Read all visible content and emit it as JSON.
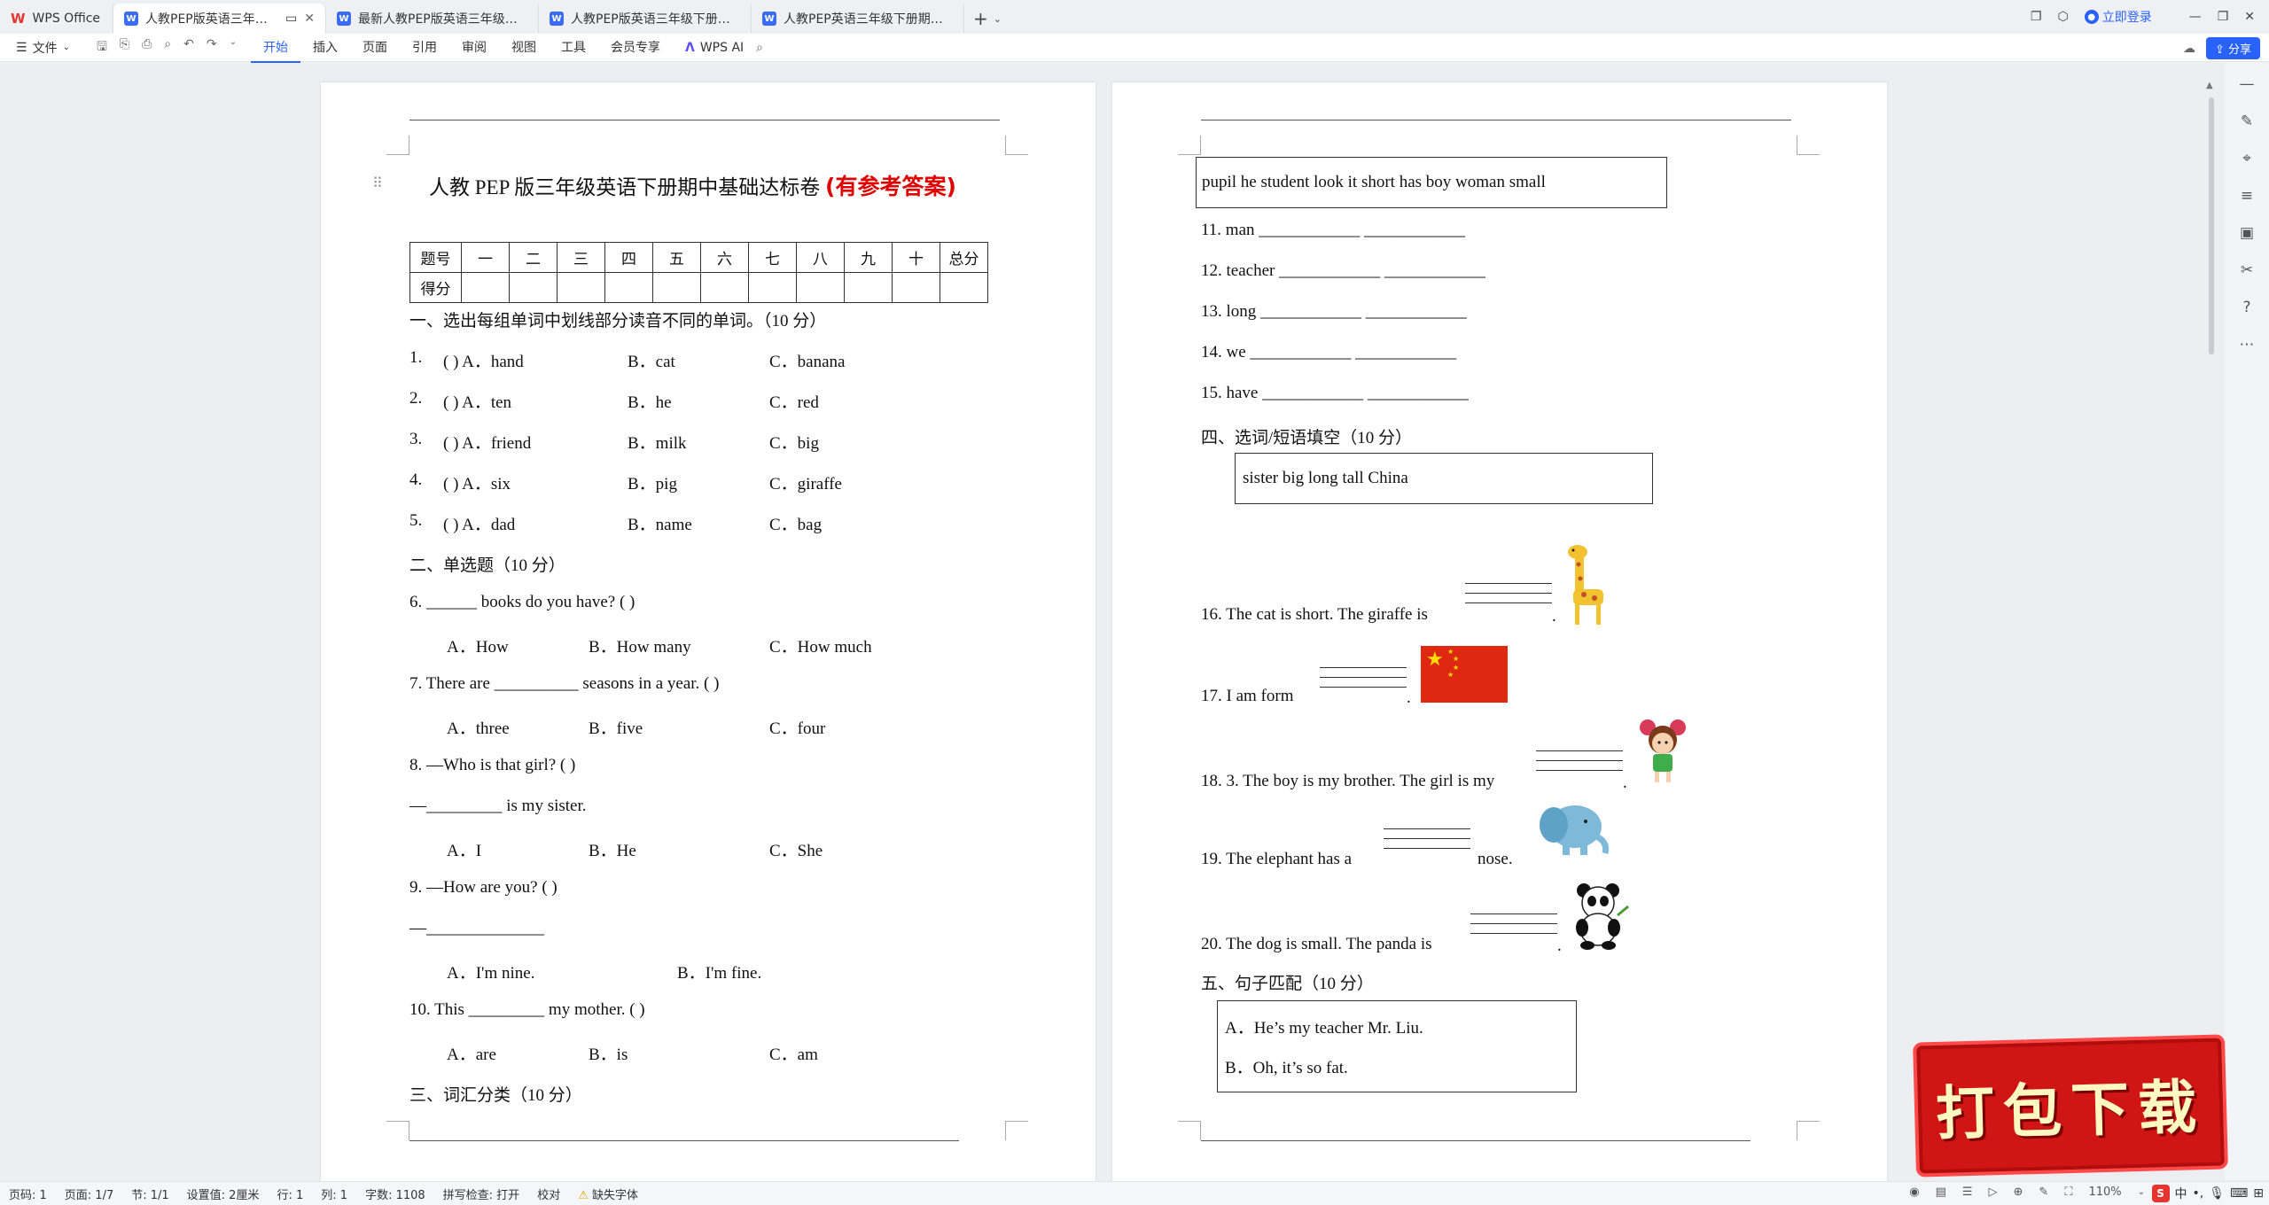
{
  "titlebar": {
    "home_tab": "WPS Office",
    "tabs": [
      {
        "label": "人教PEP版英语三年级下册期中",
        "active": true
      },
      {
        "label": "最新人教PEP版英语三年级下册期中综合"
      },
      {
        "label": "人教PEP版英语三年级下册期中能力提"
      },
      {
        "label": "人教PEP英语三年级下册期中综合素质"
      }
    ],
    "login": "立即登录"
  },
  "ribbon": {
    "file": "文件",
    "menus": [
      "开始",
      "插入",
      "页面",
      "引用",
      "审阅",
      "视图",
      "工具",
      "会员专享"
    ],
    "active_menu": "开始",
    "ai": "WPS AI",
    "share": "分享",
    "accent": "#2962ff"
  },
  "page1": {
    "title": "人教 PEP 版三年级英语下册期中基础达标卷",
    "title_red": "(有参考答案)",
    "score_table": {
      "header": [
        "题号",
        "一",
        "二",
        "三",
        "四",
        "五",
        "六",
        "七",
        "八",
        "九",
        "十",
        "总分"
      ],
      "row2_label": "得分"
    },
    "sec1": "一、选出每组单词中划线部分读音不同的单词。（10 分）",
    "q1": [
      "1.",
      "(     ) A．hand",
      "B．cat",
      "C．banana"
    ],
    "q2": [
      "2.",
      "(     ) A．ten",
      "B．he",
      "C．red"
    ],
    "q3": [
      "3.",
      "(     ) A．friend",
      "B．milk",
      "C．big"
    ],
    "q4": [
      "4.",
      "(     ) A．six",
      "B．pig",
      "C．giraffe"
    ],
    "q5": [
      "5.",
      "(     ) A．dad",
      "B．name",
      "C．bag"
    ],
    "sec2": "二、单选题（10 分）",
    "q6": "6.  ______ books do you have? (    )",
    "q6o": [
      "A．How",
      "B．How many",
      "C．How much"
    ],
    "q7": "7.  There are __________ seasons in a year. (    )",
    "q7o": [
      "A．three",
      "B．five",
      "C．four"
    ],
    "q8": "8.  —Who is that girl? (    )",
    "q8b": "—_________ is my sister.",
    "q8o": [
      "A．I",
      "B．He",
      "C．She"
    ],
    "q9": "9.  —How are you? (   )",
    "q9b": "—______________",
    "q9o": [
      "A．I'm nine.",
      "B．I'm fine."
    ],
    "q10": "10.  This _________ my mother. (   )",
    "q10o": [
      "A．are",
      "B．is",
      "C．am"
    ],
    "sec3": "三、词汇分类（10 分）"
  },
  "page2": {
    "wordbox1": "pupil  he  student  look  it  short  has  boy  woman  small",
    "q11": "11.  man ____________  ____________",
    "q12": "12.  teacher ____________  ____________",
    "q13": "13.  long ____________  ____________",
    "q14": "14.  we ____________  ____________",
    "q15": "15.  have ____________  ____________",
    "sec4": "四、选词/短语填空（10 分）",
    "wordbox2": "sister     big     long     tall     China",
    "q16": "16.  The cat is short. The giraffe is",
    "q17": "17.  I am form",
    "q18": "18.  3. The boy is my brother. The girl is my",
    "q19": "19.  The elephant has a",
    "q19b": "nose.",
    "q20": "20.  The dog is small. The panda is",
    "sec5": "五、句子匹配（10 分）",
    "matchA": "A．He’s my teacher Mr. Liu.",
    "matchB": "B．Oh, it’s so fat.",
    "flag_color": "#de2910"
  },
  "statusbar": {
    "page": "页码: 1",
    "pages": "页面: 1/7",
    "section": "节: 1/1",
    "setting": "设置值: 2厘米",
    "row": "行: 1",
    "col": "列: 1",
    "words": "字数: 1108",
    "spell": "拼写检查: 打开",
    "proof": "校对",
    "font_missing": "缺失字体",
    "zoom": "110%",
    "ime": "中"
  },
  "promo": "打包下载"
}
